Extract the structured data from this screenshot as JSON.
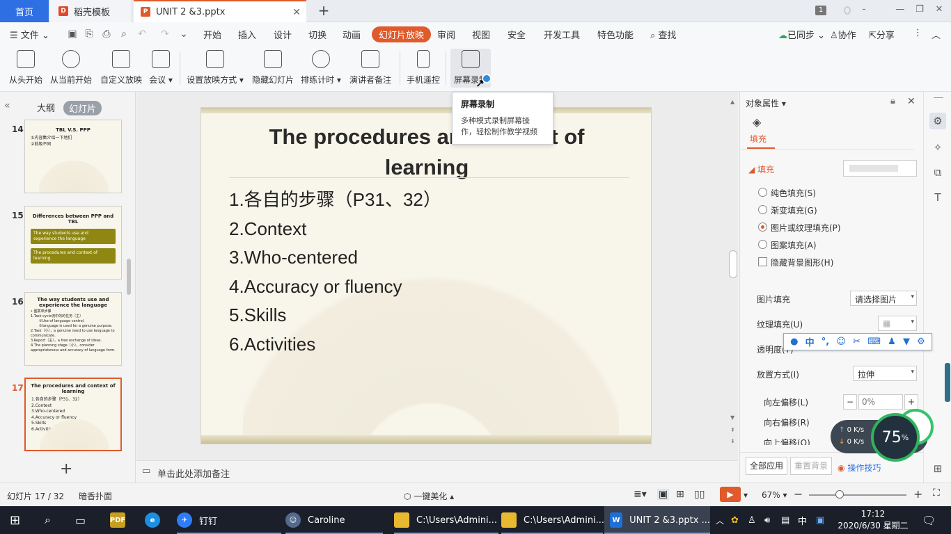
{
  "tabs": {
    "home": "首页",
    "template": "稻壳模板",
    "document": "UNIT 2 &3.pptx",
    "new": "+",
    "counter": "1"
  },
  "menu": {
    "file": "文件",
    "items": [
      "开始",
      "插入",
      "设计",
      "切换",
      "动画",
      "幻灯片放映",
      "审阅",
      "视图",
      "安全",
      "开发工具",
      "特色功能"
    ],
    "active": "幻灯片放映",
    "search": "查找",
    "sync": "已同步",
    "collab": "协作",
    "share": "分享"
  },
  "ribbon": {
    "from_start": "从头开始",
    "from_current": "从当前开始",
    "custom": "自定义放映",
    "meeting": "会议",
    "setup": "设置放映方式",
    "hide": "隐藏幻灯片",
    "timing": "排练计时",
    "presenter": "演讲者备注",
    "remote": "手机遥控",
    "record": "屏幕录制"
  },
  "tooltip": {
    "title": "屏幕录制",
    "line1": "多种模式录制屏幕操",
    "line2": "作，轻松制作教学视频"
  },
  "left_pane": {
    "outline": "大纲",
    "slides": "幻灯片",
    "add": "+",
    "thumbs": [
      {
        "num": "14",
        "title": "TBL V.S. PPP",
        "lines": [
          "①内容集介绍一下地们",
          "②前级不同"
        ]
      },
      {
        "num": "15",
        "title": "Differences between PPP and TBL",
        "boxes": [
          "The way students use and experience the language",
          "The procedures and context of learning"
        ]
      },
      {
        "num": "16",
        "title": "The way students use and experience the language",
        "lines": [
          "• 图案单步骤",
          "1.Task cycle流中的的任务（主）",
          "①Use of language control.",
          "②language is used for a genuine purpose.",
          "2.Task（小），a genuine need to use language to communicate.",
          "3.Report（主），a free exchange of ideas.",
          "4.The planning stage（小），consider appropriateness and accuracy of language form."
        ]
      },
      {
        "num": "17",
        "title": "The procedures and context of learning",
        "lines": [
          "1.各自的步骤（P31、32）",
          "2.Context",
          "3.Who-centered",
          "4.Accuracy or fluency",
          "5.Skills",
          "6.Activities"
        ]
      }
    ]
  },
  "slide": {
    "title_line1": "The procedures and context of",
    "title_line2": "learning",
    "items": [
      "1.各自的步骤（P31、32）",
      "2.Context",
      "3.Who-centered",
      "4.Accuracy or fluency",
      "5.Skills",
      "6.Activities"
    ]
  },
  "notes": "单击此处添加备注",
  "right_panel": {
    "header": "对象属性",
    "tab": "填充",
    "section": "填充",
    "solid": "纯色填充(S)",
    "gradient": "渐变填充(G)",
    "picture": "图片或纹理填充(P)",
    "pattern": "图案填充(A)",
    "hide_bg": "隐藏背景图形(H)",
    "pic_fill": "图片填充",
    "pic_fill_value": "请选择图片",
    "texture": "纹理填充(U)",
    "transparency": "透明度(T)",
    "placement": "放置方式(I)",
    "placement_value": "拉伸",
    "offset_left": "向左偏移(L)",
    "offset_left_value": "0%",
    "offset_right": "向右偏移(R)",
    "offset_up": "向上偏移(O)",
    "apply_all": "全部应用",
    "reset_bg": "重置背景",
    "tips": "操作技巧"
  },
  "net_widget": {
    "up": "0 K/s",
    "down": "0 K/s",
    "percent": "75",
    "percent_unit": "%"
  },
  "status": {
    "slide_counter": "幻灯片 17 / 32",
    "theme": "暗香扑面",
    "beautify": "一键美化",
    "zoom": "67%"
  },
  "taskbar": {
    "dingding": "钉钉",
    "caroline": "Caroline",
    "folder1": "C:\\Users\\Admini...",
    "folder2": "C:\\Users\\Admini...",
    "wps": "UNIT 2 &3.pptx ...",
    "ime": "中",
    "time": "17:12",
    "date": "2020/6/30 星期二"
  },
  "colors": {
    "accent": "#e05a2b",
    "home_blue": "#2f6fe4"
  }
}
